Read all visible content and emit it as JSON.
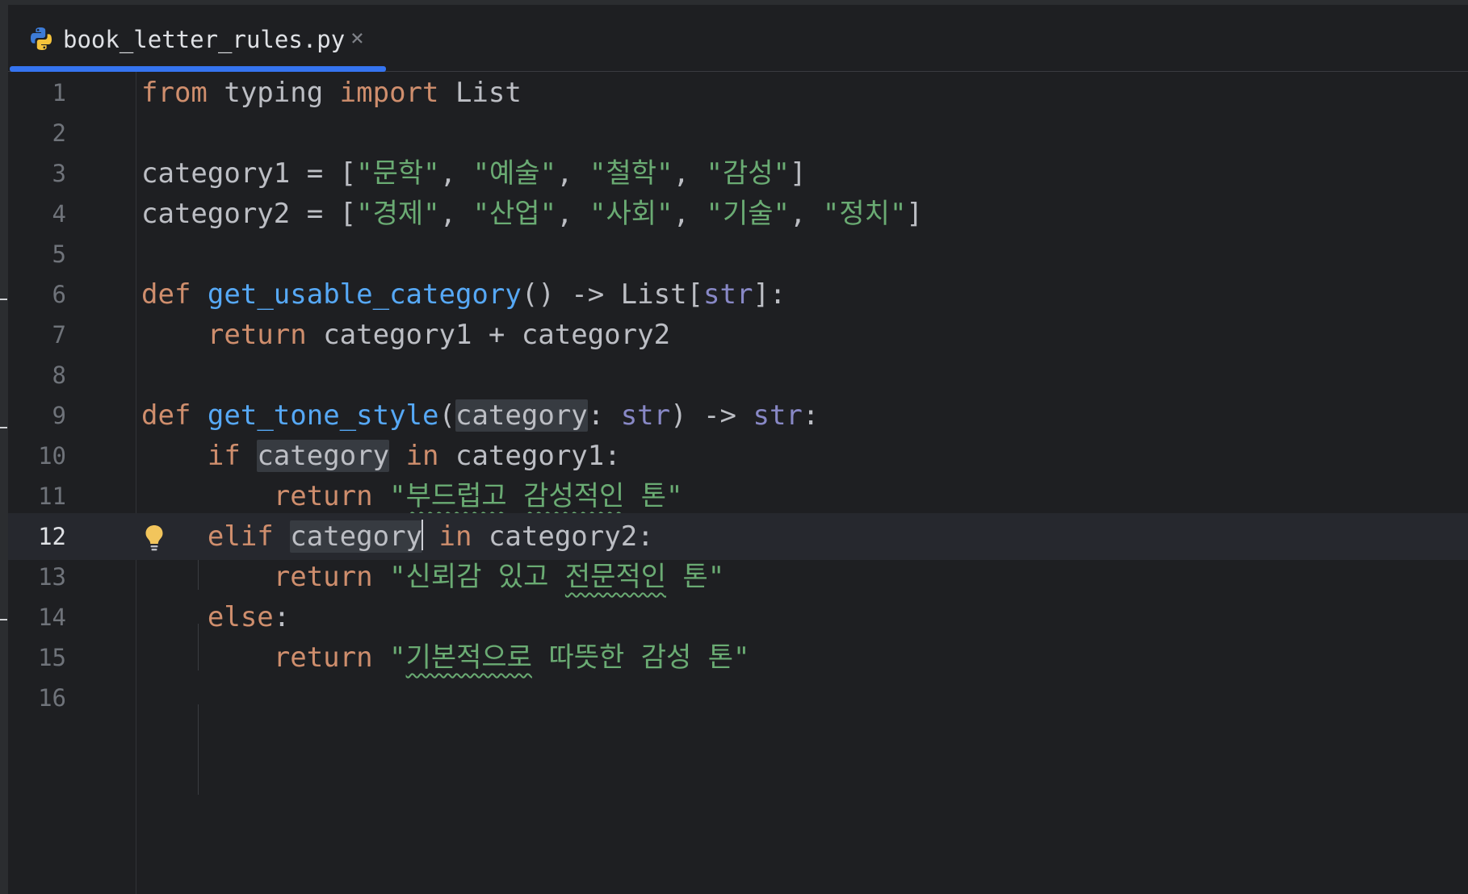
{
  "tab": {
    "title": "book_letter_rules.py",
    "close_symbol": "×",
    "icon": "python-file-icon"
  },
  "editor": {
    "current_line": 12,
    "hint_icon": "lightbulb-icon",
    "line_numbers": [
      "1",
      "2",
      "3",
      "4",
      "5",
      "6",
      "7",
      "8",
      "9",
      "10",
      "11",
      "12",
      "13",
      "14",
      "15",
      "16"
    ],
    "lines": [
      [
        {
          "t": "from",
          "c": "kw"
        },
        {
          "t": " typing "
        },
        {
          "t": "import",
          "c": "kw"
        },
        {
          "t": " List"
        }
      ],
      [],
      [
        {
          "t": "category1 = ["
        },
        {
          "t": "\"문학\"",
          "c": "st"
        },
        {
          "t": ", "
        },
        {
          "t": "\"예술\"",
          "c": "st"
        },
        {
          "t": ", "
        },
        {
          "t": "\"철학\"",
          "c": "st"
        },
        {
          "t": ", "
        },
        {
          "t": "\"감성\"",
          "c": "st"
        },
        {
          "t": "]"
        }
      ],
      [
        {
          "t": "category2 = ["
        },
        {
          "t": "\"경제\"",
          "c": "st"
        },
        {
          "t": ", "
        },
        {
          "t": "\"산업\"",
          "c": "st"
        },
        {
          "t": ", "
        },
        {
          "t": "\"사회\"",
          "c": "st"
        },
        {
          "t": ", "
        },
        {
          "t": "\"기술\"",
          "c": "st"
        },
        {
          "t": ", "
        },
        {
          "t": "\"정치\"",
          "c": "st"
        },
        {
          "t": "]"
        }
      ],
      [],
      [
        {
          "t": "def",
          "c": "kw"
        },
        {
          "t": " "
        },
        {
          "t": "get_usable_category",
          "c": "fn"
        },
        {
          "t": "() -> List["
        },
        {
          "t": "str",
          "c": "bi"
        },
        {
          "t": "]:"
        }
      ],
      [
        {
          "t": "    "
        },
        {
          "t": "return",
          "c": "kw"
        },
        {
          "t": " category1 + category2"
        }
      ],
      [],
      [
        {
          "t": "def",
          "c": "kw"
        },
        {
          "t": " "
        },
        {
          "t": "get_tone_style",
          "c": "fn"
        },
        {
          "t": "("
        },
        {
          "t": "category",
          "c": "hl"
        },
        {
          "t": ": "
        },
        {
          "t": "str",
          "c": "bi"
        },
        {
          "t": ") -> "
        },
        {
          "t": "str",
          "c": "bi"
        },
        {
          "t": ":"
        }
      ],
      [
        {
          "t": "    "
        },
        {
          "t": "if",
          "c": "kw"
        },
        {
          "t": " "
        },
        {
          "t": "category",
          "c": "hl"
        },
        {
          "t": " "
        },
        {
          "t": "in",
          "c": "kw"
        },
        {
          "t": " category1:"
        }
      ],
      [
        {
          "t": "        "
        },
        {
          "t": "return",
          "c": "kw"
        },
        {
          "t": " "
        },
        {
          "t": "\"",
          "c": "st"
        },
        {
          "t": "부드럽고",
          "c": "st squig"
        },
        {
          "t": " ",
          "c": "st"
        },
        {
          "t": "감성적인",
          "c": "st squig"
        },
        {
          "t": " 톤\"",
          "c": "st"
        }
      ],
      [
        {
          "t": "    "
        },
        {
          "t": "elif",
          "c": "kw"
        },
        {
          "t": " "
        },
        {
          "t": "category",
          "c": "hl caret-after"
        },
        {
          "t": " "
        },
        {
          "t": "in",
          "c": "kw"
        },
        {
          "t": " category2:"
        }
      ],
      [
        {
          "t": "        "
        },
        {
          "t": "return",
          "c": "kw"
        },
        {
          "t": " "
        },
        {
          "t": "\"신뢰감 있고 ",
          "c": "st"
        },
        {
          "t": "전문적인",
          "c": "st squig"
        },
        {
          "t": " 톤\"",
          "c": "st"
        }
      ],
      [
        {
          "t": "    "
        },
        {
          "t": "else",
          "c": "kw"
        },
        {
          "t": ":"
        }
      ],
      [
        {
          "t": "        "
        },
        {
          "t": "return",
          "c": "kw"
        },
        {
          "t": " "
        },
        {
          "t": "\"",
          "c": "st"
        },
        {
          "t": "기본적으로",
          "c": "st squig"
        },
        {
          "t": " 따뜻한 감성 톤\"",
          "c": "st"
        }
      ],
      []
    ]
  },
  "colors": {
    "background": "#1e1f22",
    "keyword": "#cf8e6d",
    "function": "#56a8f5",
    "builtin": "#8888c6",
    "string": "#6aab73",
    "text": "#bcbec4",
    "tab_accent": "#3574f0"
  }
}
